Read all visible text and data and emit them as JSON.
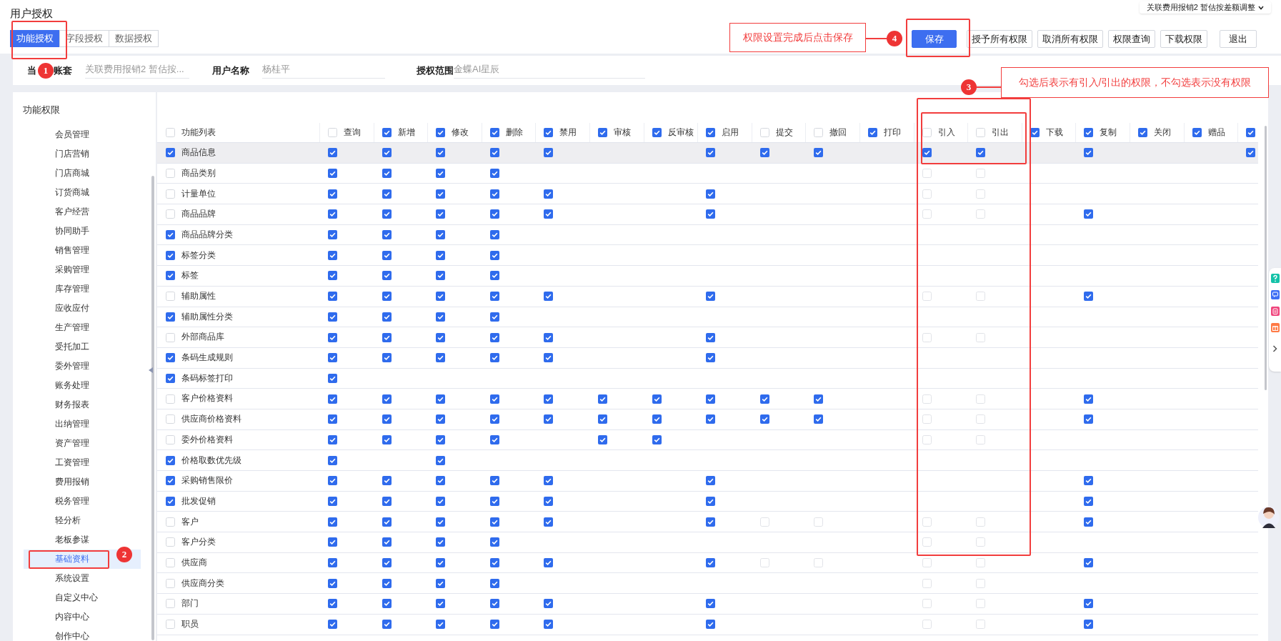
{
  "page_title": "用户授权",
  "account_switcher": {
    "label": "关联费用报销2 暂估按差额调整"
  },
  "tabs": [
    {
      "label": "功能授权",
      "selected": true
    },
    {
      "label": "字段授权",
      "selected": false
    },
    {
      "label": "数据授权",
      "selected": false
    }
  ],
  "toolbar_buttons": [
    {
      "label": "保存",
      "kind": "primary"
    },
    {
      "label": "授予所有权限",
      "kind": "default"
    },
    {
      "label": "取消所有权限",
      "kind": "default"
    },
    {
      "label": "权限查询",
      "kind": "default"
    },
    {
      "label": "下载权限",
      "kind": "default"
    },
    {
      "label": "退出",
      "kind": "default"
    }
  ],
  "info_fields": [
    {
      "label_parts": [
        "当",
        "账套"
      ],
      "value": "关联费用报销2 暂估按..."
    },
    {
      "label_parts": [
        "用户名称"
      ],
      "value": "杨桂平"
    },
    {
      "label_parts": [
        "授权范围"
      ],
      "value": "金蝶AI星辰"
    }
  ],
  "sidebar": {
    "title": "功能权限",
    "items": [
      {
        "label": "会员管理",
        "selected": false
      },
      {
        "label": "门店营销",
        "selected": false
      },
      {
        "label": "门店商城",
        "selected": false
      },
      {
        "label": "订货商城",
        "selected": false
      },
      {
        "label": "客户经营",
        "selected": false
      },
      {
        "label": "协同助手",
        "selected": false
      },
      {
        "label": "销售管理",
        "selected": false
      },
      {
        "label": "采购管理",
        "selected": false
      },
      {
        "label": "库存管理",
        "selected": false
      },
      {
        "label": "应收应付",
        "selected": false
      },
      {
        "label": "生产管理",
        "selected": false
      },
      {
        "label": "受托加工",
        "selected": false
      },
      {
        "label": "委外管理",
        "selected": false
      },
      {
        "label": "账务处理",
        "selected": false
      },
      {
        "label": "财务报表",
        "selected": false
      },
      {
        "label": "出纳管理",
        "selected": false
      },
      {
        "label": "资产管理",
        "selected": false
      },
      {
        "label": "工资管理",
        "selected": false
      },
      {
        "label": "费用报销",
        "selected": false
      },
      {
        "label": "税务管理",
        "selected": false
      },
      {
        "label": "轻分析",
        "selected": false
      },
      {
        "label": "老板参谋",
        "selected": false
      },
      {
        "label": "基础资料",
        "selected": true
      },
      {
        "label": "系统设置",
        "selected": false
      },
      {
        "label": "自定义中心",
        "selected": false
      },
      {
        "label": "内容中心",
        "selected": false
      },
      {
        "label": "创作中心",
        "selected": false
      }
    ]
  },
  "table": {
    "columns": [
      {
        "label": "功能列表",
        "checked": false
      },
      {
        "label": "查询",
        "checked": false
      },
      {
        "label": "新增",
        "checked": true
      },
      {
        "label": "修改",
        "checked": true
      },
      {
        "label": "删除",
        "checked": true
      },
      {
        "label": "禁用",
        "checked": true
      },
      {
        "label": "审核",
        "checked": true
      },
      {
        "label": "反审核",
        "checked": true
      },
      {
        "label": "启用",
        "checked": true
      },
      {
        "label": "提交",
        "checked": false
      },
      {
        "label": "撤回",
        "checked": false
      },
      {
        "label": "打印",
        "checked": true
      },
      {
        "label": "引入",
        "checked": false
      },
      {
        "label": "引出",
        "checked": false
      },
      {
        "label": "下载",
        "checked": true
      },
      {
        "label": "复制",
        "checked": true
      },
      {
        "label": "关闭",
        "checked": true
      },
      {
        "label": "赠品",
        "checked": true
      },
      {
        "checked": true
      }
    ],
    "rows": [
      {
        "label": "商品信息",
        "checked": true,
        "selected": true,
        "cells": [
          true,
          true,
          true,
          true,
          true,
          null,
          null,
          true,
          true,
          true,
          null,
          true,
          true,
          null,
          true,
          null,
          null,
          true
        ]
      },
      {
        "label": "商品类别",
        "checked": false,
        "selected": false,
        "cells": [
          true,
          true,
          true,
          true,
          null,
          null,
          null,
          null,
          null,
          null,
          null,
          false,
          false,
          null,
          null,
          null,
          null,
          null
        ]
      },
      {
        "label": "计量单位",
        "checked": false,
        "selected": false,
        "cells": [
          true,
          true,
          true,
          true,
          true,
          null,
          null,
          true,
          null,
          null,
          null,
          false,
          false,
          null,
          null,
          null,
          null,
          null
        ]
      },
      {
        "label": "商品品牌",
        "checked": false,
        "selected": false,
        "cells": [
          true,
          true,
          true,
          true,
          true,
          null,
          null,
          true,
          null,
          null,
          null,
          false,
          false,
          null,
          true,
          null,
          null,
          null
        ]
      },
      {
        "label": "商品品牌分类",
        "checked": true,
        "selected": false,
        "cells": [
          true,
          true,
          true,
          true,
          null,
          null,
          null,
          null,
          null,
          null,
          null,
          null,
          null,
          null,
          null,
          null,
          null,
          null
        ]
      },
      {
        "label": "标签分类",
        "checked": true,
        "selected": false,
        "cells": [
          true,
          true,
          true,
          true,
          null,
          null,
          null,
          null,
          null,
          null,
          null,
          null,
          null,
          null,
          null,
          null,
          null,
          null
        ]
      },
      {
        "label": "标签",
        "checked": true,
        "selected": false,
        "cells": [
          true,
          true,
          true,
          true,
          null,
          null,
          null,
          null,
          null,
          null,
          null,
          null,
          null,
          null,
          null,
          null,
          null,
          null
        ]
      },
      {
        "label": "辅助属性",
        "checked": false,
        "selected": false,
        "cells": [
          true,
          true,
          true,
          true,
          true,
          null,
          null,
          true,
          null,
          null,
          null,
          false,
          false,
          null,
          true,
          null,
          null,
          null
        ]
      },
      {
        "label": "辅助属性分类",
        "checked": true,
        "selected": false,
        "cells": [
          true,
          true,
          true,
          true,
          null,
          null,
          null,
          null,
          null,
          null,
          null,
          null,
          null,
          null,
          null,
          null,
          null,
          null
        ]
      },
      {
        "label": "外部商品库",
        "checked": false,
        "selected": false,
        "cells": [
          true,
          true,
          true,
          true,
          true,
          null,
          null,
          true,
          null,
          null,
          null,
          false,
          false,
          null,
          null,
          null,
          null,
          null
        ]
      },
      {
        "label": "条码生成规则",
        "checked": true,
        "selected": false,
        "cells": [
          true,
          true,
          true,
          true,
          true,
          null,
          null,
          true,
          null,
          null,
          null,
          null,
          null,
          null,
          null,
          null,
          null,
          null
        ]
      },
      {
        "label": "条码标签打印",
        "checked": true,
        "selected": false,
        "cells": [
          true,
          null,
          null,
          null,
          null,
          null,
          null,
          null,
          null,
          null,
          null,
          null,
          null,
          null,
          null,
          null,
          null,
          null
        ]
      },
      {
        "label": "客户价格资料",
        "checked": false,
        "selected": false,
        "cells": [
          true,
          true,
          true,
          true,
          true,
          true,
          true,
          true,
          true,
          true,
          null,
          false,
          false,
          null,
          true,
          null,
          null,
          null
        ]
      },
      {
        "label": "供应商价格资料",
        "checked": false,
        "selected": false,
        "cells": [
          true,
          true,
          true,
          true,
          true,
          true,
          true,
          true,
          true,
          true,
          null,
          false,
          false,
          null,
          true,
          null,
          null,
          null
        ]
      },
      {
        "label": "委外价格资料",
        "checked": false,
        "selected": false,
        "cells": [
          true,
          true,
          true,
          true,
          null,
          true,
          true,
          null,
          null,
          null,
          null,
          false,
          false,
          null,
          null,
          null,
          null,
          null
        ]
      },
      {
        "label": "价格取数优先级",
        "checked": true,
        "selected": false,
        "cells": [
          true,
          null,
          true,
          null,
          null,
          null,
          null,
          null,
          null,
          null,
          null,
          null,
          null,
          null,
          null,
          null,
          null,
          null
        ]
      },
      {
        "label": "采购销售限价",
        "checked": true,
        "selected": false,
        "cells": [
          true,
          true,
          true,
          true,
          true,
          null,
          null,
          true,
          null,
          null,
          null,
          null,
          null,
          null,
          true,
          null,
          null,
          null
        ]
      },
      {
        "label": "批发促销",
        "checked": true,
        "selected": false,
        "cells": [
          true,
          true,
          true,
          true,
          true,
          null,
          null,
          true,
          null,
          null,
          null,
          null,
          null,
          null,
          true,
          null,
          null,
          null
        ]
      },
      {
        "label": "客户",
        "checked": false,
        "selected": false,
        "cells": [
          true,
          true,
          true,
          true,
          true,
          null,
          null,
          true,
          false,
          false,
          null,
          false,
          false,
          null,
          true,
          null,
          null,
          null
        ]
      },
      {
        "label": "客户分类",
        "checked": false,
        "selected": false,
        "cells": [
          true,
          true,
          true,
          true,
          null,
          null,
          null,
          null,
          null,
          null,
          null,
          false,
          false,
          null,
          null,
          null,
          null,
          null
        ]
      },
      {
        "label": "供应商",
        "checked": false,
        "selected": false,
        "cells": [
          true,
          true,
          true,
          true,
          true,
          null,
          null,
          true,
          false,
          false,
          null,
          false,
          false,
          null,
          true,
          null,
          null,
          null
        ]
      },
      {
        "label": "供应商分类",
        "checked": false,
        "selected": false,
        "cells": [
          true,
          true,
          true,
          true,
          null,
          null,
          null,
          null,
          null,
          null,
          null,
          false,
          false,
          null,
          null,
          null,
          null,
          null
        ]
      },
      {
        "label": "部门",
        "checked": false,
        "selected": false,
        "cells": [
          true,
          true,
          true,
          true,
          true,
          null,
          null,
          true,
          null,
          null,
          null,
          false,
          false,
          null,
          true,
          null,
          null,
          null
        ]
      },
      {
        "label": "职员",
        "checked": false,
        "selected": false,
        "cells": [
          true,
          true,
          true,
          true,
          true,
          null,
          null,
          true,
          null,
          null,
          null,
          false,
          false,
          null,
          true,
          null,
          null,
          null
        ]
      }
    ]
  },
  "annotations": [
    {
      "number": "1"
    },
    {
      "number": "2"
    },
    {
      "number": "3",
      "text": "勾选后表示有引入/引出的权限，不勾选表示没有权限"
    },
    {
      "number": "4",
      "text": "权限设置完成后点击保存"
    }
  ]
}
